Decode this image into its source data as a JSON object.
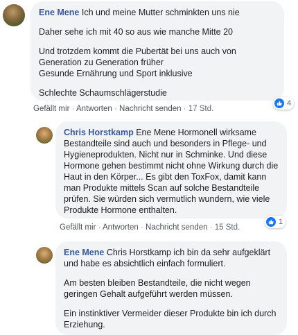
{
  "comments": [
    {
      "author": "Ene Mene",
      "paragraphs": [
        "Ich und meine Mutter schminkten uns nie",
        "Daher sehe ich mit 40 so aus wie manche Mitte 20",
        "Und trotzdem kommt die Pubertät bei uns auch von Generation zu Generation früher\nGesunde Ernährung und Sport inklusive",
        "Schlechte Schaumschlägerstudie"
      ],
      "actions": {
        "like": "Gefällt mir",
        "reply": "Antworten",
        "message": "Nachricht senden",
        "time": "17 Std."
      },
      "reactions": "4"
    },
    {
      "author": "Chris Horstkamp",
      "paragraphs": [
        "Ene Mene Hormonell wirksame Bestandteile sind auch und besonders in Pflege- und Hygieneprodukten. Nicht nur in Schminke. Und diese Hormone gehen bestimmt nicht ohne Wirkung durch die Haut in den Körper... Es gibt den ToxFox, damit kann man Produkte mittels Scan auf solche Bestandteile prüfen. Sie würden sich vermutlich wundern, wie viele Produkte Hormone enthalten."
      ],
      "actions": {
        "like": "Gefällt mir",
        "reply": "Antworten",
        "message": "Nachricht senden",
        "time": "15 Std."
      },
      "reactions": "1"
    },
    {
      "author": "Ene Mene",
      "paragraphs": [
        "Chris Horstkamp ich bin da sehr aufgeklärt und habe es absichtlich einfach formuliert.",
        "Am besten bleiben Bestandteile, die nicht wegen geringen Gehalt aufgeführt werden müssen.",
        "Ein instinktiver Vermeider dieser Produkte bin ich durch Erziehung."
      ]
    }
  ],
  "icons": {
    "reaction": "like-thumb-icon"
  },
  "colors": {
    "author": "#385898",
    "bubble": "#f2f3f5",
    "like": "#1877f2"
  }
}
